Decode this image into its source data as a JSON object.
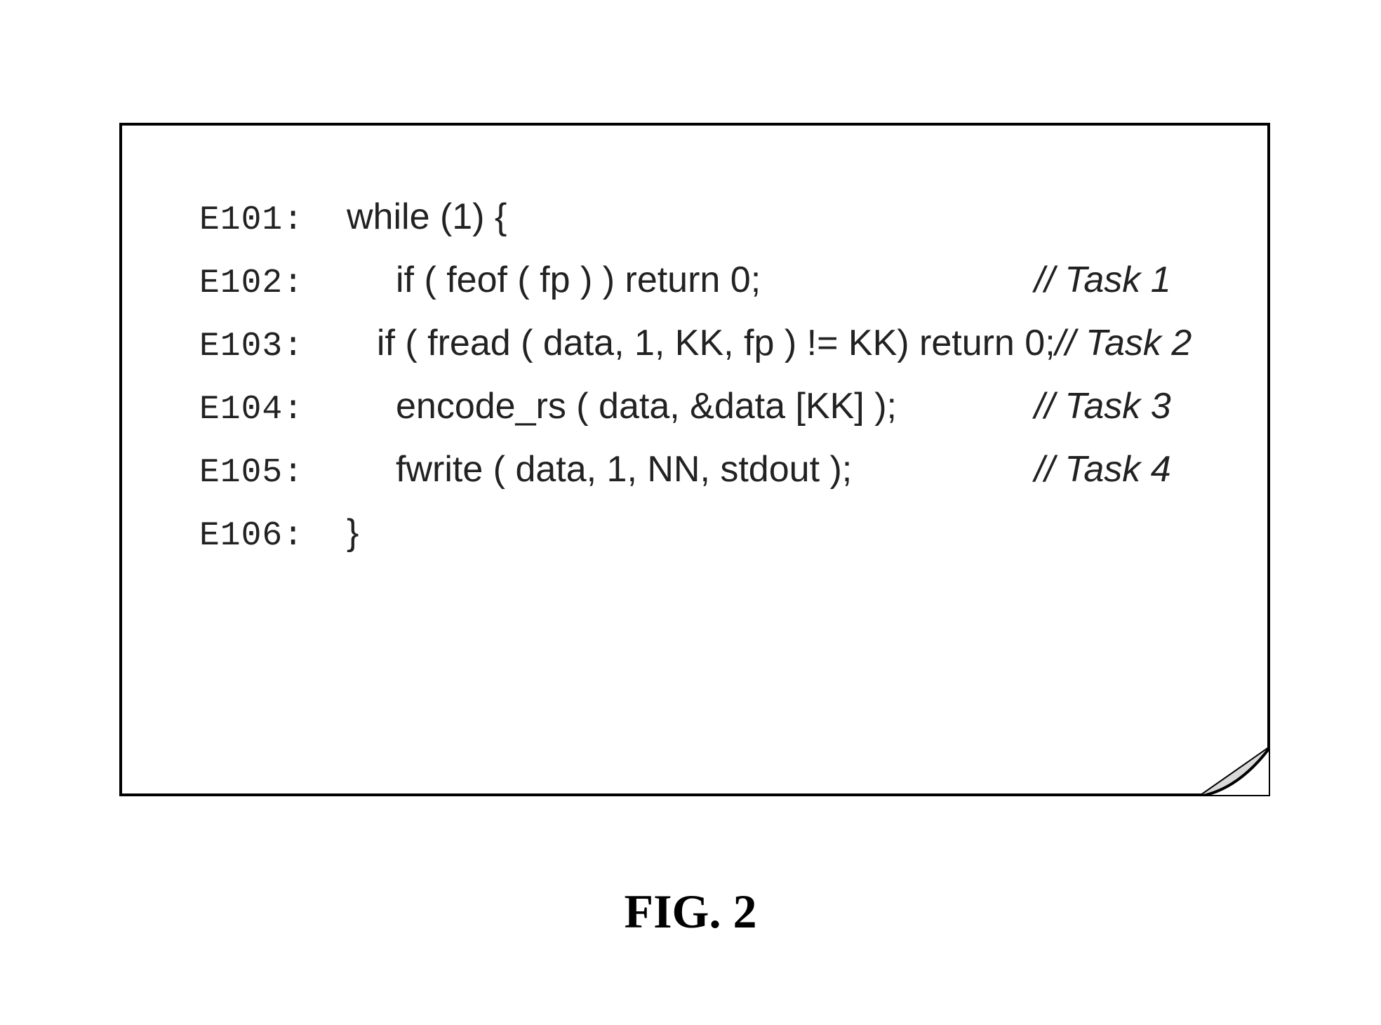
{
  "figure": {
    "caption": "FIG. 2",
    "lines": [
      {
        "num": "E101:",
        "code": "while (1) {",
        "comment": "",
        "indent": false
      },
      {
        "num": "E102:",
        "code": "if ( feof ( fp ) ) return 0;",
        "comment": "// Task 1",
        "indent": true
      },
      {
        "num": "E103:",
        "code": "if ( fread ( data, 1, KK, fp ) != KK) return 0;",
        "comment": "// Task 2",
        "indent": true
      },
      {
        "num": "E104:",
        "code": "encode_rs ( data, &data [KK] );",
        "comment": "// Task 3",
        "indent": true
      },
      {
        "num": "E105:",
        "code": "fwrite ( data, 1, NN, stdout );",
        "comment": "// Task 4",
        "indent": true
      },
      {
        "num": "E106:",
        "code": "}",
        "comment": "",
        "indent": false
      }
    ]
  }
}
